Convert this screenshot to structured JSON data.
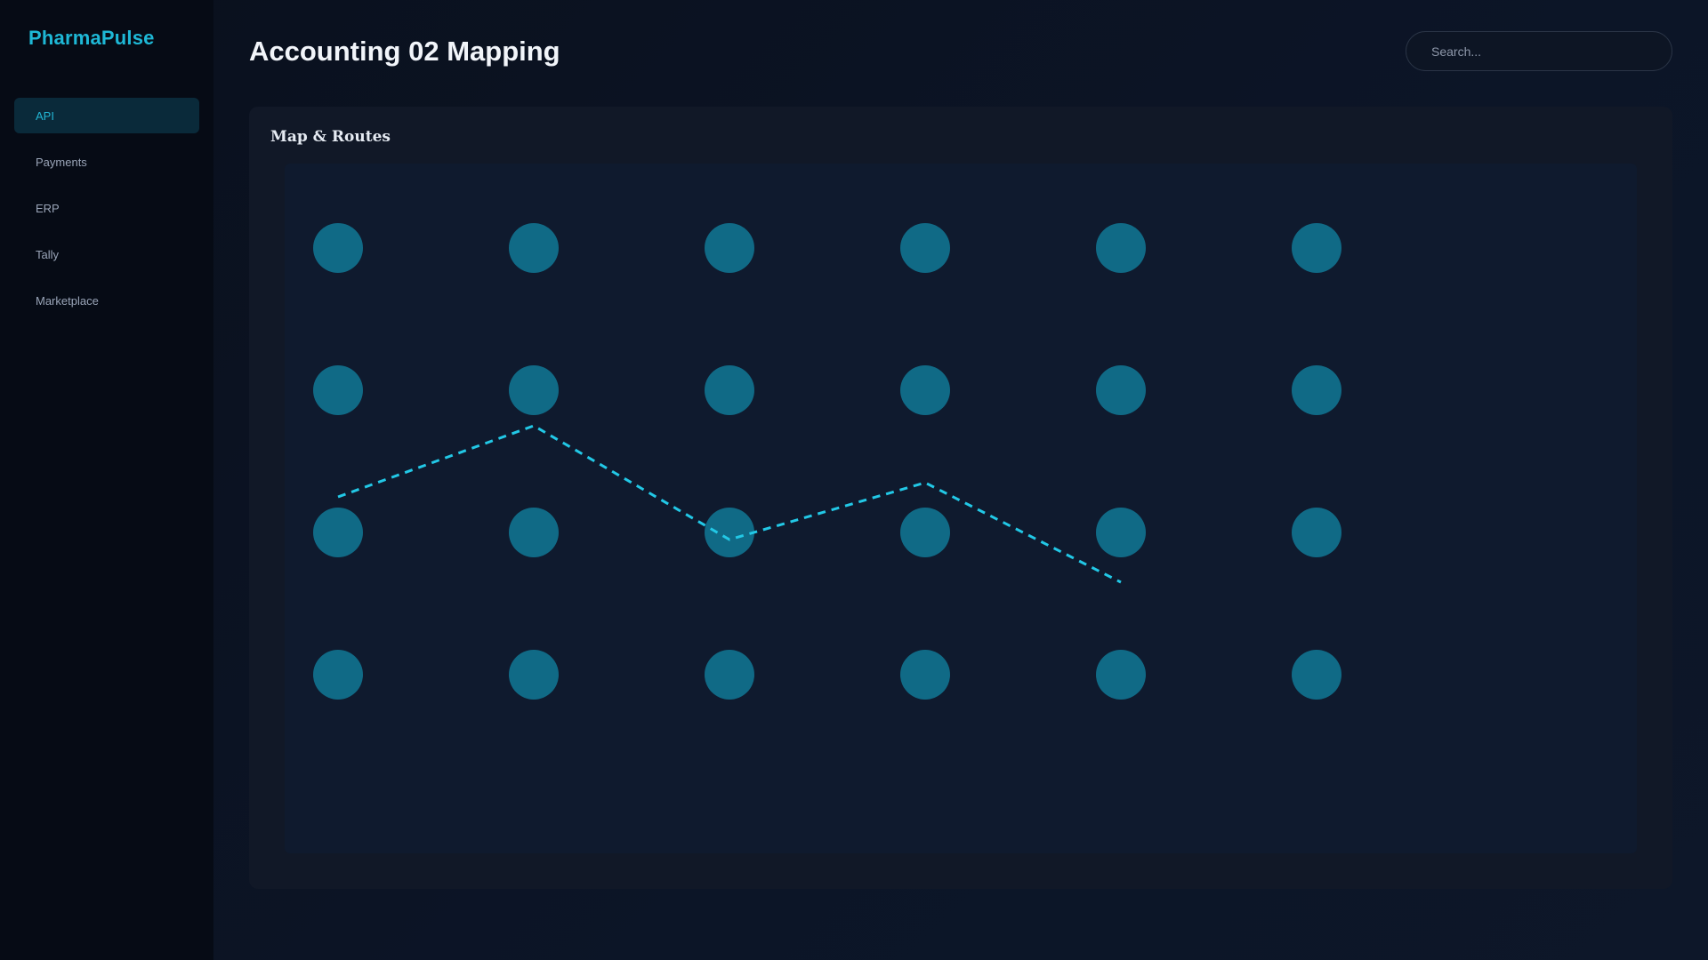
{
  "app": {
    "brand": "PharmaPulse"
  },
  "sidebar": {
    "items": [
      {
        "label": "API",
        "active": true
      },
      {
        "label": "Payments",
        "active": false
      },
      {
        "label": "ERP",
        "active": false
      },
      {
        "label": "Tally",
        "active": false
      },
      {
        "label": "Marketplace",
        "active": false
      }
    ]
  },
  "header": {
    "title": "Accounting 02 Mapping",
    "search_placeholder": "Search..."
  },
  "panel": {
    "title": "Map & Routes"
  },
  "map": {
    "node_rows": 4,
    "node_cols": 6,
    "route": [
      {
        "row": 1.75,
        "col": 0
      },
      {
        "row": 1.25,
        "col": 1
      },
      {
        "row": 2.05,
        "col": 2
      },
      {
        "row": 1.65,
        "col": 3
      },
      {
        "row": 2.35,
        "col": 4
      }
    ]
  },
  "colors": {
    "accent": "#1eb8d6",
    "node": "#106a86",
    "route": "#22c8e6",
    "background": "#0a1120",
    "panel": "#111827"
  }
}
